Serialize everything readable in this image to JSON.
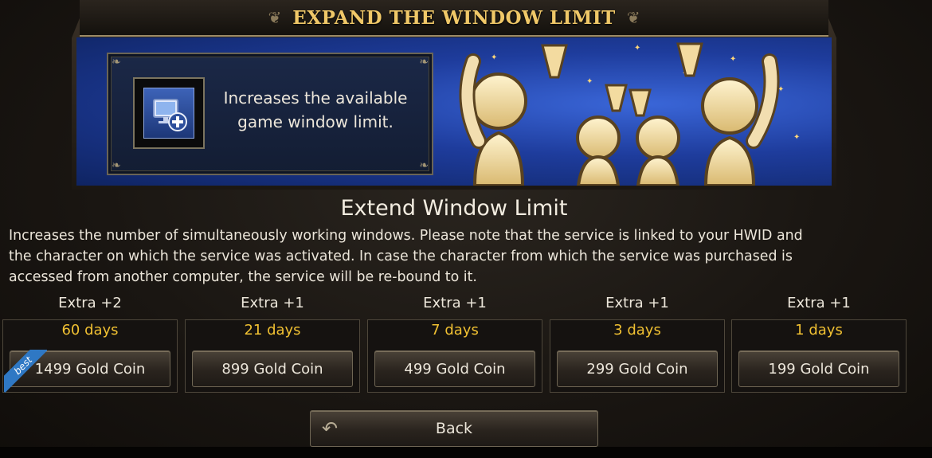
{
  "header": {
    "title": "EXPAND THE WINDOW LIMIT"
  },
  "panel": {
    "desc_line1": "Increases the available",
    "desc_line2": "game window limit."
  },
  "main": {
    "title": "Extend Window Limit",
    "desc_line1": "Increases the number of simultaneously working windows. Please note that the service is linked to your HWID and",
    "desc_line2": "the character on which the service was activated. In case the character from which the service was purchased is",
    "desc_line3": "accessed from another computer, the service will be re-bound to it."
  },
  "options": [
    {
      "label": "Extra +2",
      "days": "60 days",
      "price": "1499 Gold Coin",
      "badge": "best"
    },
    {
      "label": "Extra +1",
      "days": "21 days",
      "price": "899 Gold Coin"
    },
    {
      "label": "Extra +1",
      "days": "7 days",
      "price": "499 Gold Coin"
    },
    {
      "label": "Extra +1",
      "days": "3 days",
      "price": "299 Gold Coin"
    },
    {
      "label": "Extra +1",
      "days": "1 days",
      "price": "199 Gold Coin"
    }
  ],
  "back": {
    "label": "Back"
  },
  "icons": {
    "service": "monitor-plus-icon",
    "back": "back-arrow-icon",
    "ornament": "ornament-icon"
  },
  "colors": {
    "title_gold": "#f0c868",
    "days_gold": "#f0c032",
    "banner_blue": "#1e3c9c",
    "ribbon_blue": "#2f78c4"
  }
}
